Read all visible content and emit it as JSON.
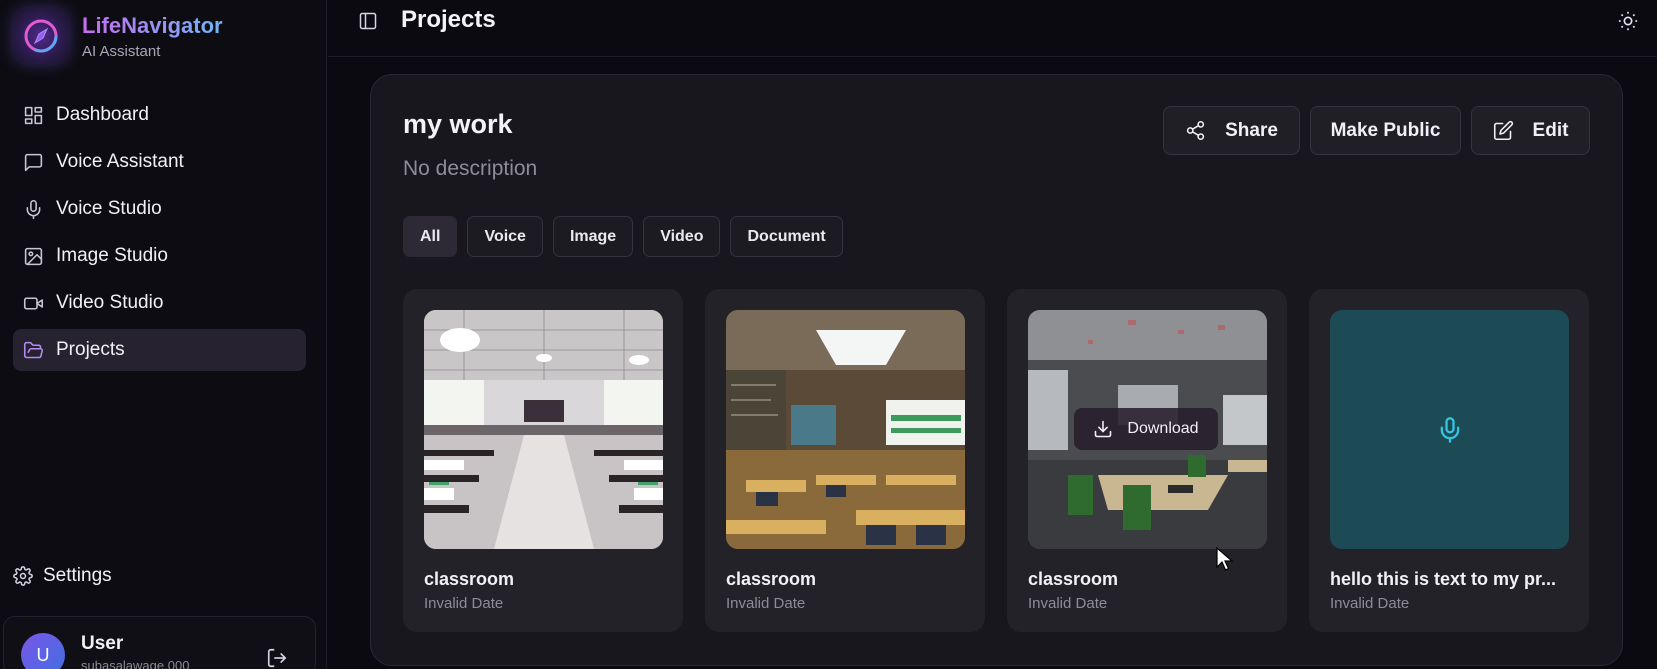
{
  "brand": {
    "name": "LifeNavigator",
    "subtitle": "AI Assistant"
  },
  "nav": {
    "items": [
      {
        "label": "Dashboard",
        "icon": "dashboard-icon"
      },
      {
        "label": "Voice Assistant",
        "icon": "message-square-icon"
      },
      {
        "label": "Voice Studio",
        "icon": "mic-icon"
      },
      {
        "label": "Image Studio",
        "icon": "image-icon"
      },
      {
        "label": "Video Studio",
        "icon": "video-icon"
      },
      {
        "label": "Projects",
        "icon": "folder-open-icon",
        "active": true
      }
    ],
    "settings_label": "Settings"
  },
  "user": {
    "initial": "U",
    "name": "User",
    "email": "subasalawage.000"
  },
  "header": {
    "title": "Projects"
  },
  "project": {
    "title": "my work",
    "description": "No description",
    "actions": {
      "share": "Share",
      "make_public": "Make Public",
      "edit": "Edit"
    },
    "filters": [
      "All",
      "Voice",
      "Image",
      "Video",
      "Document"
    ],
    "active_filter": "All",
    "items": [
      {
        "title": "classroom",
        "date": "Invalid Date",
        "type": "image"
      },
      {
        "title": "classroom",
        "date": "Invalid Date",
        "type": "image"
      },
      {
        "title": "classroom",
        "date": "Invalid Date",
        "type": "image",
        "hover_action": "Download"
      },
      {
        "title": "hello this is text to my pr...",
        "date": "Invalid Date",
        "type": "voice"
      }
    ]
  },
  "colors": {
    "accent": "#b78cf2",
    "audio_tile": "#1c4a55",
    "audio_icon": "#36c3df"
  }
}
